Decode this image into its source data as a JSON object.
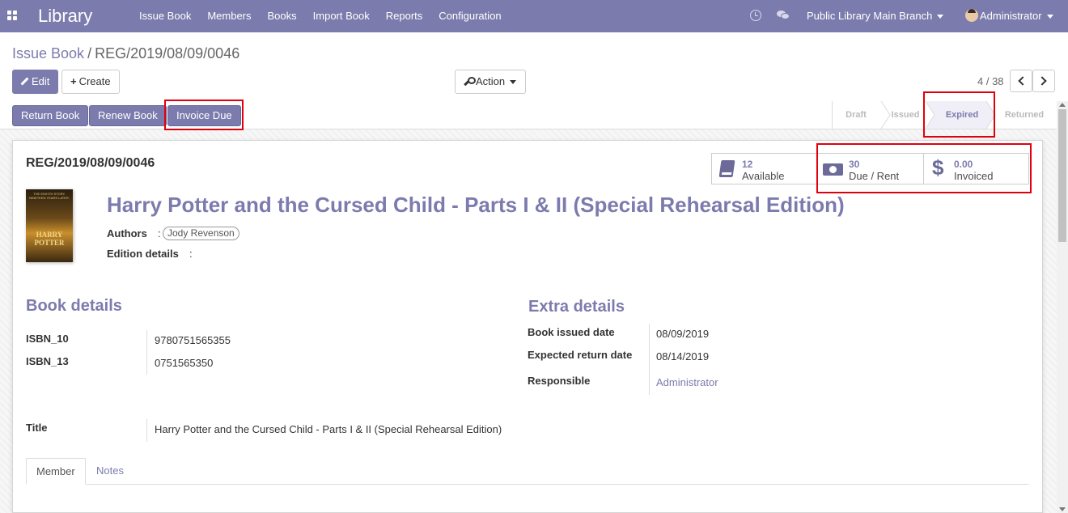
{
  "navbar": {
    "app_title": "Library",
    "menu": [
      "Issue Book",
      "Members",
      "Books",
      "Import Book",
      "Reports",
      "Configuration"
    ],
    "branch": "Public Library Main Branch",
    "user": "Administrator",
    "color": "#7c7bad"
  },
  "breadcrumb": {
    "parent": "Issue Book",
    "separator": "/",
    "current": "REG/2019/08/09/0046"
  },
  "toolbar": {
    "edit": "Edit",
    "create": "Create",
    "action": "Action"
  },
  "pager": {
    "value": "4 / 38"
  },
  "statusbar": {
    "buttons": [
      "Return Book",
      "Renew Book",
      "Invoice Due"
    ],
    "steps": [
      "Draft",
      "Issued",
      "Expired",
      "Returned"
    ],
    "active_step": "Expired"
  },
  "record": {
    "reference": "REG/2019/08/09/0046",
    "stats": [
      {
        "value": "12",
        "label": "Available",
        "icon": "book-icon"
      },
      {
        "value": "30",
        "label": "Due / Rent",
        "icon": "money-icon"
      },
      {
        "value": "0.00",
        "label": "Invoiced",
        "icon": "dollar-icon"
      }
    ],
    "cover": {
      "top_text": "THE EIGHTH STORY. NINETEEN YEARS LATER.",
      "line1": "HARRY",
      "line2": "POTTER"
    },
    "title": "Harry Potter and the Cursed Child - Parts I & II (Special Rehearsal Edition)",
    "authors_label": "Authors",
    "authors": [
      "Jody Revenson"
    ],
    "edition_label": "Edition details",
    "edition_value": ""
  },
  "book_details": {
    "heading": "Book details",
    "isbn10_label": "ISBN_10",
    "isbn10": "9780751565355",
    "isbn13_label": "ISBN_13",
    "isbn13": "0751565350",
    "title_label": "Title",
    "title": "Harry Potter and the Cursed Child - Parts I & II (Special Rehearsal Edition)"
  },
  "extra_details": {
    "heading": "Extra details",
    "issued_label": "Book issued date",
    "issued": "08/09/2019",
    "expected_label": "Expected return date",
    "expected": "08/14/2019",
    "responsible_label": "Responsible",
    "responsible": "Administrator"
  },
  "tabs": [
    "Member",
    "Notes"
  ],
  "highlight_color": "#e0000c"
}
